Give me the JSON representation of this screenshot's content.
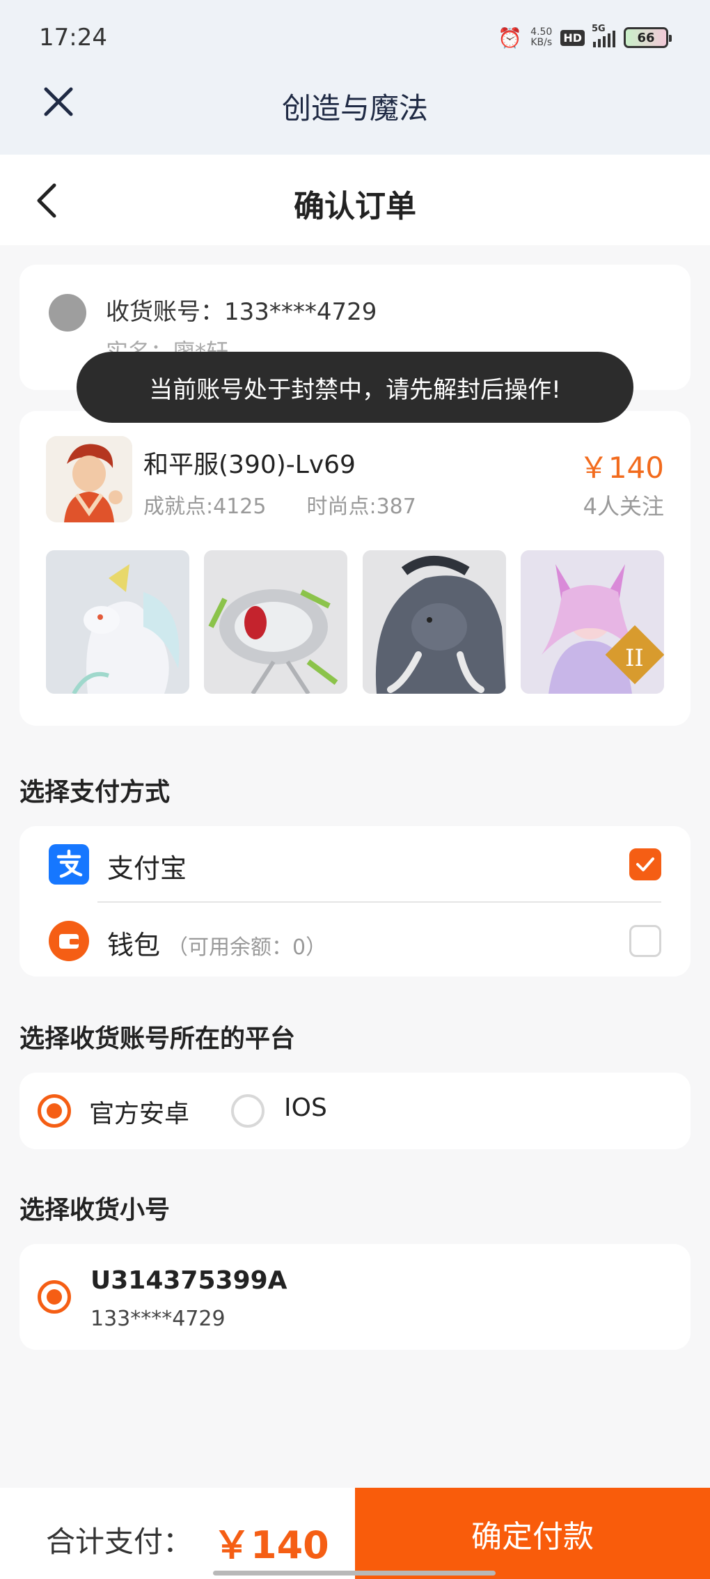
{
  "status_bar": {
    "time": "17:24",
    "net_speed_value": "4.50",
    "net_speed_unit": "KB/s",
    "hd": "HD",
    "network": "5G",
    "battery": "66"
  },
  "app_bar": {
    "title": "创造与魔法"
  },
  "page_header": {
    "title": "确认订单"
  },
  "account": {
    "label": "收货账号：133****4729",
    "real_name": "实名：廖*轩"
  },
  "toast": {
    "message": "当前账号处于封禁中，请先解封后操作!"
  },
  "product": {
    "name": "和平服(390)-Lv69",
    "achievement": "成就点:4125",
    "fashion": "时尚点:387",
    "price": "￥140",
    "followers": "4人关注",
    "thumbnails": [
      "white-fox-mount",
      "silver-beetle-mount",
      "mammoth-mount",
      "pink-fox-costume"
    ]
  },
  "payment": {
    "section_title": "选择支付方式",
    "options": [
      {
        "label": "支付宝",
        "note": "",
        "checked": true,
        "icon": "alipay-icon"
      },
      {
        "label": "钱包",
        "note": "（可用余额：0）",
        "checked": false,
        "icon": "wallet-icon"
      }
    ]
  },
  "platform": {
    "section_title": "选择收货账号所在的平台",
    "options": [
      {
        "label": "官方安卓",
        "selected": true
      },
      {
        "label": "IOS",
        "selected": false
      }
    ]
  },
  "alt_account": {
    "section_title": "选择收货小号",
    "id": "U314375399A",
    "phone": "133****4729",
    "selected": true
  },
  "footer": {
    "total_label": "合计支付：",
    "total_value": "￥140",
    "confirm_label": "确定付款"
  },
  "colors": {
    "accent": "#f55e14",
    "price": "#f26b1d",
    "alipay": "#1677ff"
  }
}
